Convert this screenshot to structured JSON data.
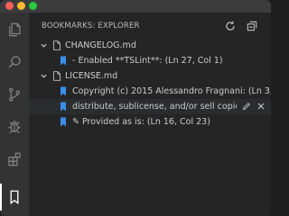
{
  "sidebar": {
    "title": "BOOKMARKS: EXPLORER"
  },
  "tree": {
    "files": [
      {
        "name": "CHANGELOG.md",
        "bookmarks": [
          {
            "label": "- Enabled **TSLint**: (Ln 27, Col 1)"
          }
        ]
      },
      {
        "name": "LICENSE.md",
        "bookmarks": [
          {
            "label": "Copyright (c) 2015 Alessandro Fragnani: (Ln 3,..."
          },
          {
            "label": "distribute, sublicense, and/or sell copie..."
          },
          {
            "label": "✎ Provided as is: (Ln 16, Col 23)"
          }
        ]
      }
    ]
  },
  "colors": {
    "bookmark": "#3b8eea",
    "titlebar": "#3c3c3c",
    "activitybar": "#333333",
    "sidebar": "#252526"
  }
}
